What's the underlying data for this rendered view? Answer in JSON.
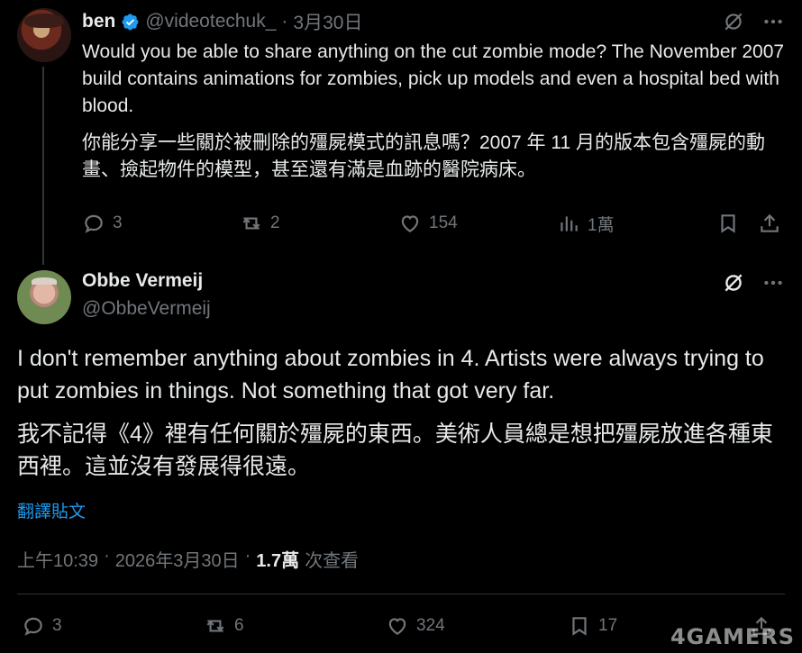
{
  "reply": {
    "author_name": "ben",
    "handle": "@videotechuk_",
    "separator": "·",
    "date": "3月30日",
    "text_en": "Would you be able to share anything on the cut zombie mode? The November 2007 build contains animations for zombies, pick up models and even a hospital bed with blood.",
    "text_zh": "你能分享一些關於被刪除的殭屍模式的訊息嗎？2007 年 11 月的版本包含殭屍的動畫、撿起物件的模型，甚至還有滿是血跡的醫院病床。",
    "stats": {
      "replies": "3",
      "reposts": "2",
      "likes": "154",
      "views": "1萬"
    }
  },
  "main": {
    "author_name": "Obbe Vermeij",
    "handle": "@ObbeVermeij",
    "text_en": "I don't remember anything about zombies in 4. Artists were always trying to put zombies in things. Not something that got very far.",
    "text_zh": "我不記得《4》裡有任何關於殭屍的東西。美術人員總是想把殭屍放進各種東西裡。這並沒有發展得很遠。",
    "translate_label": "翻譯貼文",
    "time": "上午10:39",
    "meta_sep": "·",
    "date": "2026年3月30日",
    "views_count": "1.7萬",
    "views_label": "次查看",
    "stats": {
      "replies": "3",
      "reposts": "6",
      "likes": "324",
      "bookmarks": "17"
    }
  },
  "watermark": "4GAMERS",
  "colors": {
    "background": "#000000",
    "text": "#e7e9ea",
    "muted": "#71767b",
    "accent": "#1d9bf0",
    "divider": "#2f3336"
  }
}
